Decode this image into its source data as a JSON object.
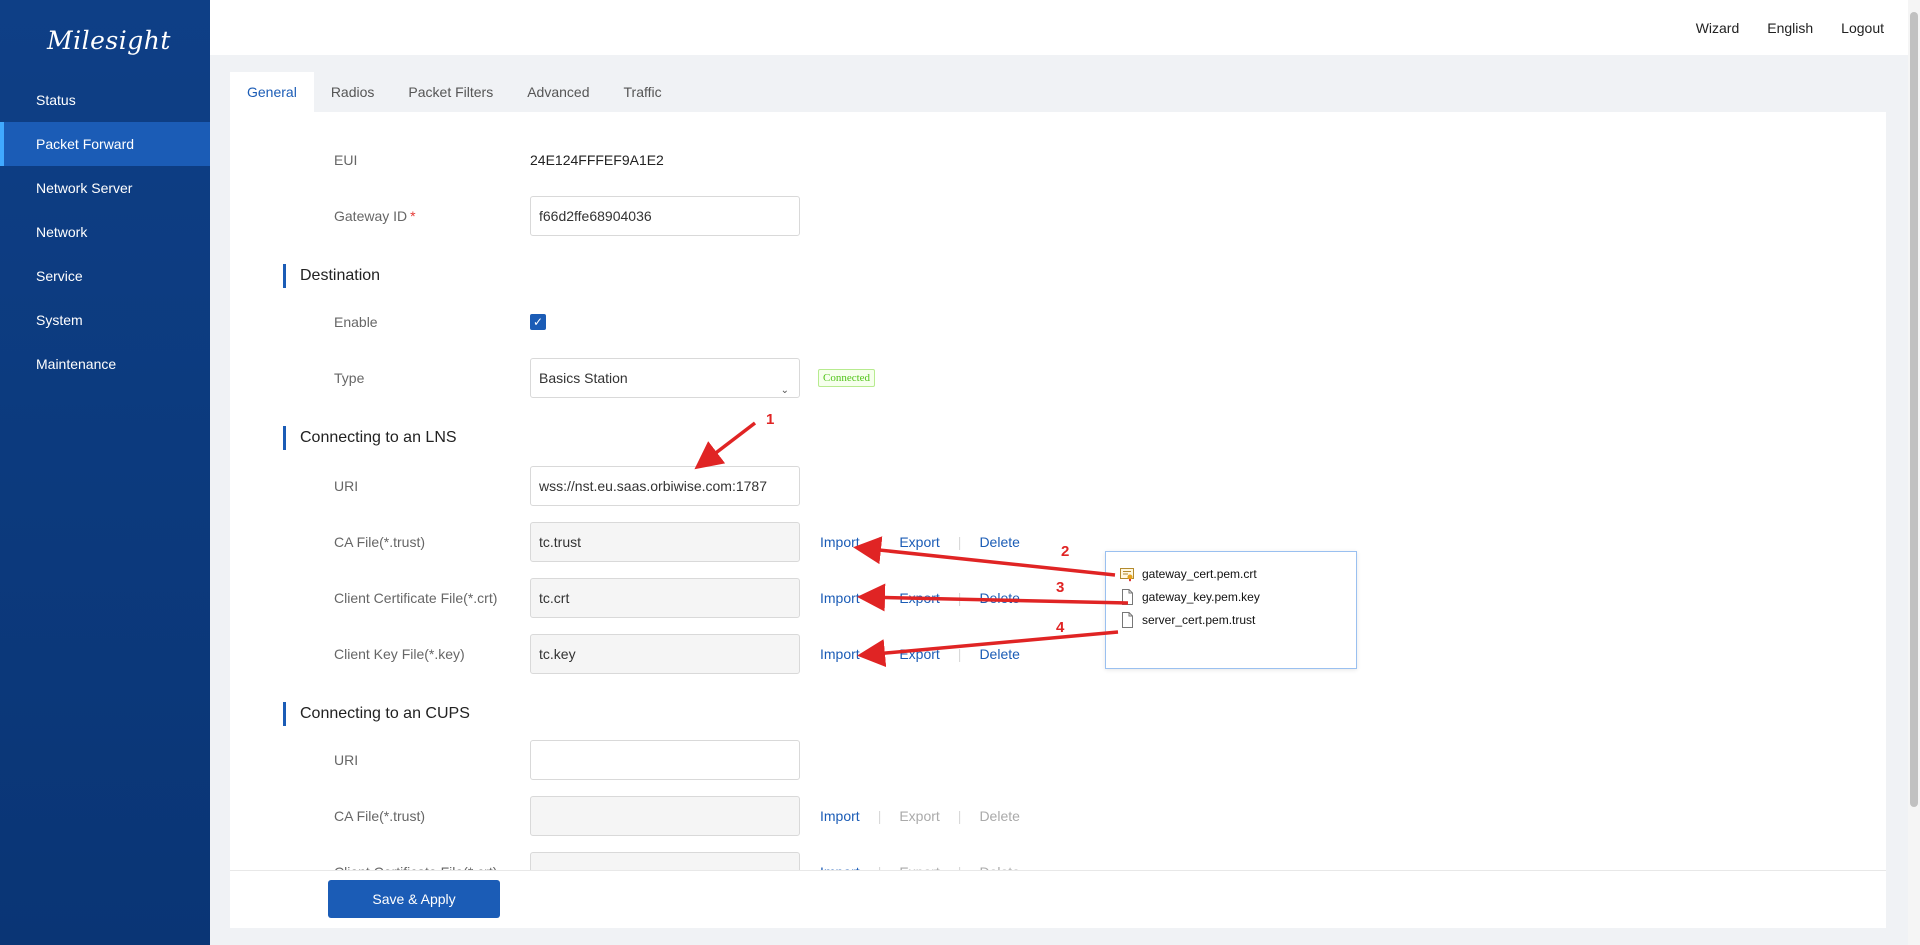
{
  "brand": {
    "logo": "Milesight"
  },
  "sidebar": {
    "items": [
      {
        "label": "Status"
      },
      {
        "label": "Packet Forward",
        "active": true
      },
      {
        "label": "Network Server"
      },
      {
        "label": "Network"
      },
      {
        "label": "Service"
      },
      {
        "label": "System"
      },
      {
        "label": "Maintenance"
      }
    ]
  },
  "header": {
    "wizard": "Wizard",
    "language": "English",
    "logout": "Logout"
  },
  "tabs": [
    {
      "label": "General",
      "active": true
    },
    {
      "label": "Radios"
    },
    {
      "label": "Packet Filters"
    },
    {
      "label": "Advanced"
    },
    {
      "label": "Traffic"
    }
  ],
  "general": {
    "eui_label": "EUI",
    "eui_value": "24E124FFFEF9A1E2",
    "gateway_id_label": "Gateway ID",
    "gateway_id_required": "*",
    "gateway_id_value": "f66d2ffe68904036"
  },
  "destination": {
    "title": "Destination",
    "enable_label": "Enable",
    "enable_checked": true,
    "type_label": "Type",
    "type_value": "Basics Station",
    "status_badge": "Connected"
  },
  "lns": {
    "title": "Connecting to an LNS",
    "uri_label": "URI",
    "uri_value": "wss://nst.eu.saas.orbiwise.com:1787",
    "ca_label": "CA File(*.trust)",
    "ca_value": "tc.trust",
    "cert_label": "Client Certificate File(*.crt)",
    "cert_value": "tc.crt",
    "key_label": "Client Key File(*.key)",
    "key_value": "tc.key"
  },
  "cups": {
    "title": "Connecting to an CUPS",
    "uri_label": "URI",
    "uri_value": "",
    "ca_label": "CA File(*.trust)",
    "ca_value": "",
    "cert_label": "Client Certificate File(*.crt)"
  },
  "actions": {
    "import": "Import",
    "export": "Export",
    "delete": "Delete"
  },
  "footer": {
    "save_label": "Save & Apply"
  },
  "file_popup": {
    "files": [
      {
        "name": "gateway_cert.pem.crt",
        "icon": "certificate-file-icon"
      },
      {
        "name": "gateway_key.pem.key",
        "icon": "file-icon"
      },
      {
        "name": "server_cert.pem.trust",
        "icon": "file-icon"
      }
    ]
  },
  "annotations": {
    "n1": "1",
    "n2": "2",
    "n3": "3",
    "n4": "4",
    "color": "#e02424"
  },
  "colors": {
    "sidebar": "#0e3f86",
    "accent": "#1b5cb6",
    "active_nav": "#1b5cb6",
    "success": "#52c41a"
  }
}
